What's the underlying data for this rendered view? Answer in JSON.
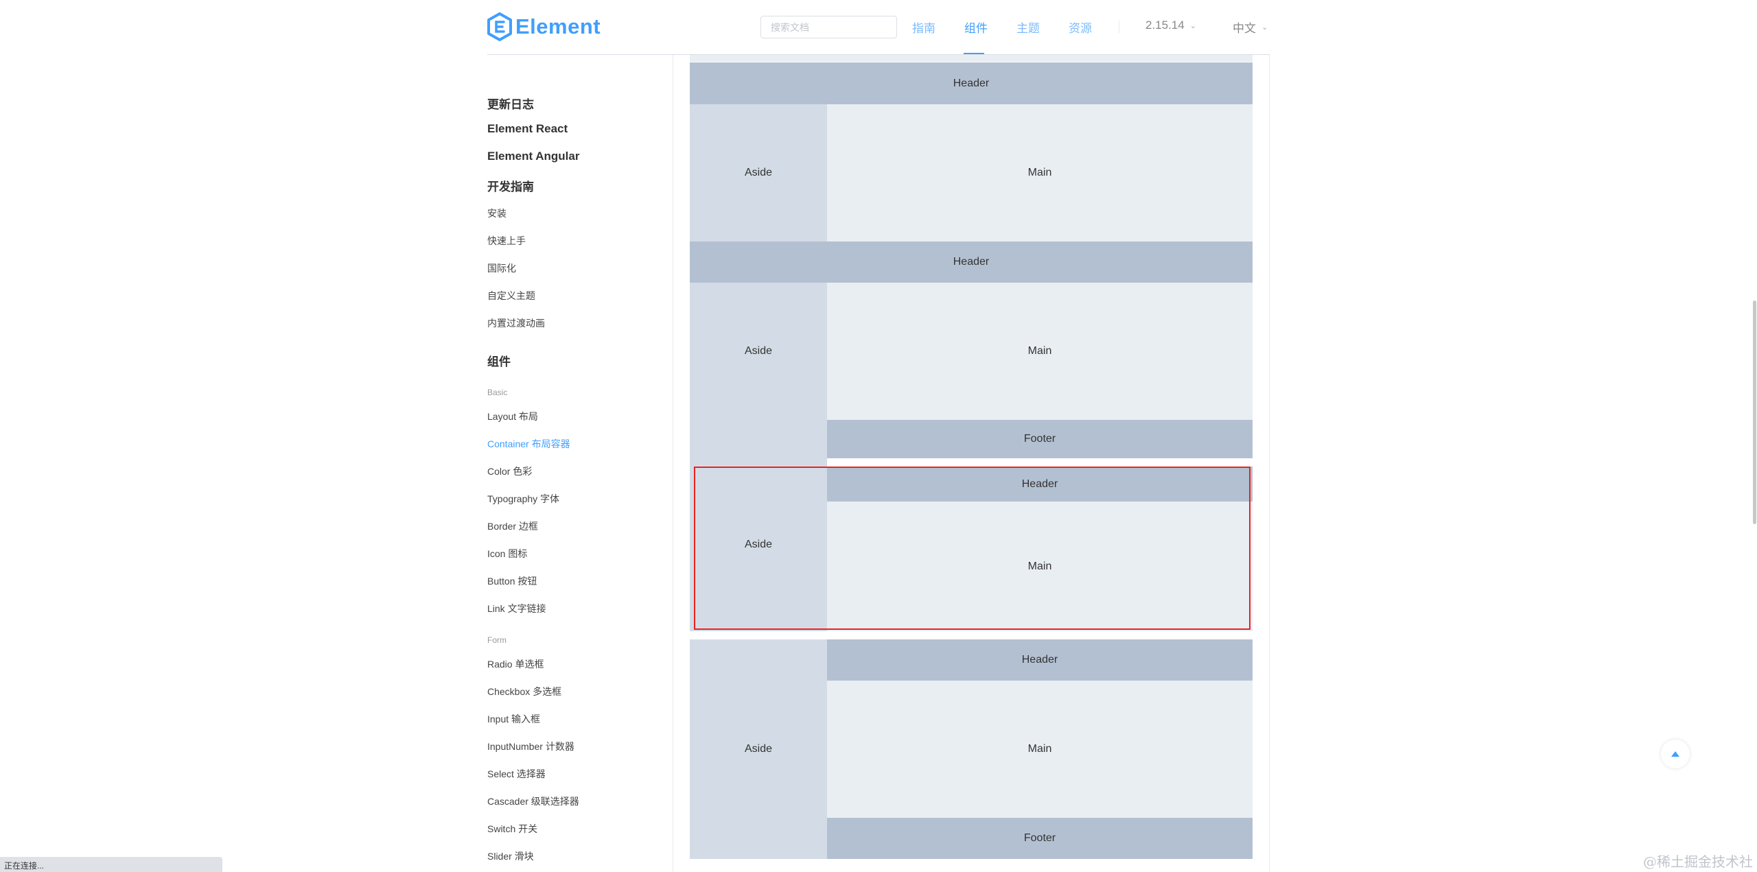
{
  "header": {
    "logo_text": "Element",
    "search_placeholder": "搜索文档",
    "nav": {
      "guide": "指南",
      "component": "组件",
      "theme": "主题",
      "resource": "资源"
    },
    "version": "2.15.14",
    "language": "中文",
    "colors": {
      "accent": "#409eff"
    }
  },
  "sidebar": {
    "top": [
      "更新日志",
      "Element React",
      "Element Angular",
      "开发指南"
    ],
    "guide_items": [
      "安装",
      "快速上手",
      "国际化",
      "自定义主题",
      "内置过渡动画"
    ],
    "components_title": "组件",
    "group_basic": "Basic",
    "basic_items": [
      "Layout 布局",
      "Container 布局容器",
      "Color 色彩",
      "Typography 字体",
      "Border 边框",
      "Icon 图标",
      "Button 按钮",
      "Link 文字链接"
    ],
    "group_form": "Form",
    "form_items": [
      "Radio 单选框",
      "Checkbox 多选框",
      "Input 输入框",
      "InputNumber 计数器",
      "Select 选择器",
      "Cascader 级联选择器",
      "Switch 开关",
      "Slider 滑块"
    ],
    "active_item": "Container 布局容器"
  },
  "demo": {
    "header": "Header",
    "aside": "Aside",
    "main": "Main",
    "footer": "Footer",
    "colors": {
      "header_footer": "#b3c0d1",
      "aside": "#d3dce6",
      "main": "#e9eef3",
      "highlight": "#ec2121"
    }
  },
  "status_text": "正在连接...",
  "watermark": "@稀土掘金技术社区"
}
